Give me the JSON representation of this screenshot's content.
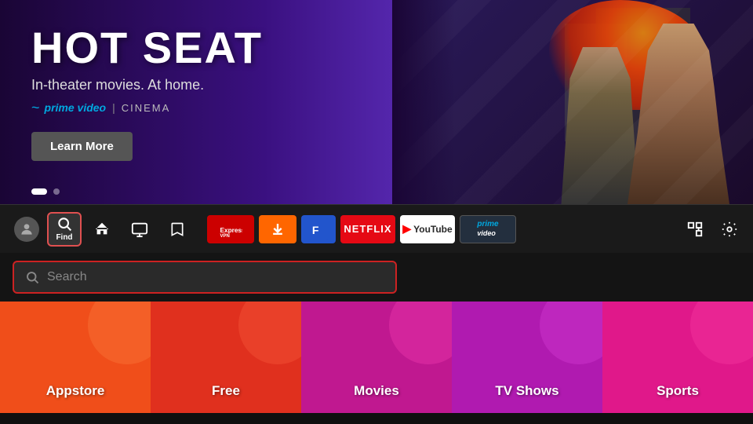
{
  "hero": {
    "title": "HOT SEAT",
    "subtitle": "In-theater movies. At home.",
    "brand_prime": "prime video",
    "brand_divider": "|",
    "brand_cinema": "CINEMA",
    "learn_more": "Learn More",
    "dots": [
      {
        "active": true
      },
      {
        "active": false
      }
    ]
  },
  "nav": {
    "find_label": "Find",
    "apps": [
      {
        "name": "ExpressVPN",
        "type": "expressvpn"
      },
      {
        "name": "Downloader",
        "type": "downloader"
      },
      {
        "name": "F",
        "type": "blue"
      },
      {
        "name": "NETFLIX",
        "type": "netflix"
      },
      {
        "name": "YouTube",
        "type": "youtube"
      },
      {
        "name": "prime video",
        "type": "prime"
      }
    ]
  },
  "search": {
    "placeholder": "Search"
  },
  "categories": [
    {
      "label": "Appstore",
      "type": "appstore"
    },
    {
      "label": "Free",
      "type": "free"
    },
    {
      "label": "Movies",
      "type": "movies"
    },
    {
      "label": "TV Shows",
      "type": "tvshows"
    },
    {
      "label": "Sports",
      "type": "sports"
    }
  ]
}
